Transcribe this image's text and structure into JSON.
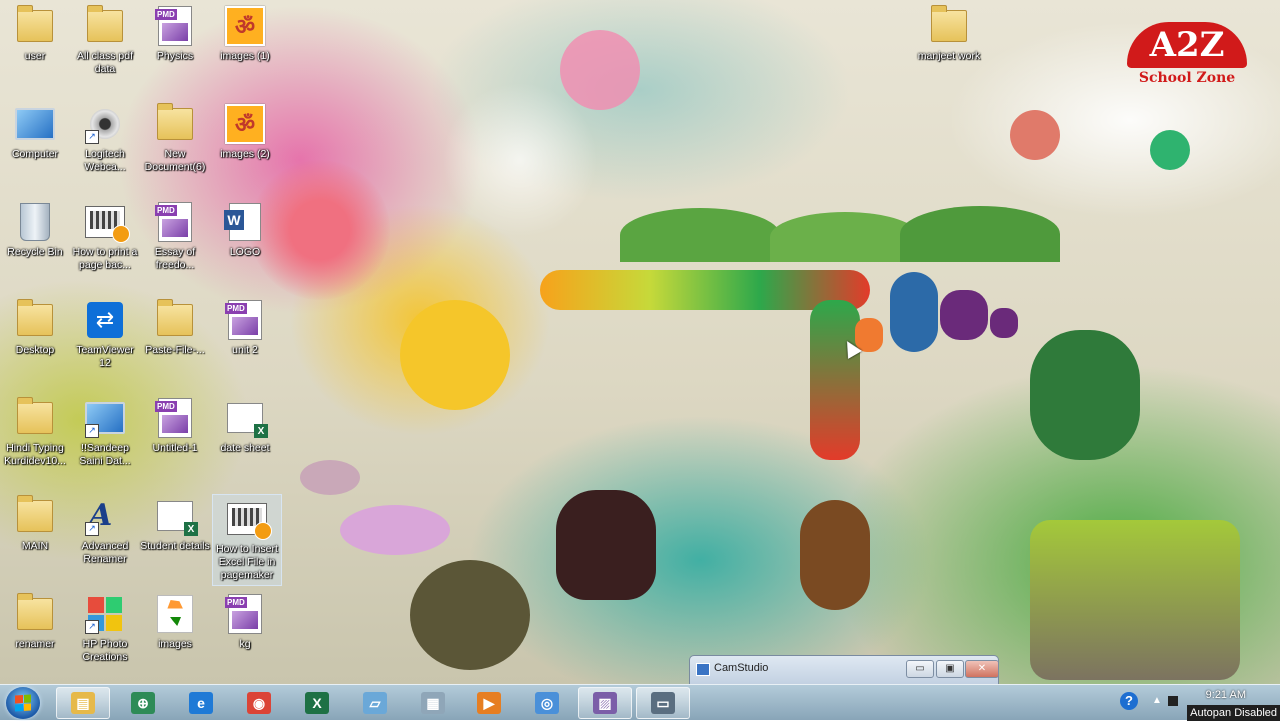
{
  "desktop": {
    "icons": [
      {
        "label": "user",
        "type": "user-folder-icon"
      },
      {
        "label": "All class pdf data",
        "type": "folder-icon"
      },
      {
        "label": "Physics",
        "type": "pmd-file-icon"
      },
      {
        "label": "images (1)",
        "type": "om-image-icon"
      },
      {
        "label": "Computer",
        "type": "computer-icon"
      },
      {
        "label": "Logitech Webca...",
        "type": "webcam-icon"
      },
      {
        "label": "New Document(6)",
        "type": "folder-icon"
      },
      {
        "label": "images (2)",
        "type": "om-image-icon"
      },
      {
        "label": "Recycle Bin",
        "type": "recycle-bin-icon"
      },
      {
        "label": "How to print a page bac...",
        "type": "video-file-icon"
      },
      {
        "label": "Essay of freedo...",
        "type": "pmd-file-icon"
      },
      {
        "label": "LOGO",
        "type": "word-document-icon"
      },
      {
        "label": "Desktop",
        "type": "folder-icon"
      },
      {
        "label": "TeamViewer 12",
        "type": "teamviewer-icon"
      },
      {
        "label": "Paste-File-...",
        "type": "folder-icon"
      },
      {
        "label": "unit 2",
        "type": "pmd-file-icon"
      },
      {
        "label": "Hindi Typing Kurdidev10...",
        "type": "folder-icon"
      },
      {
        "label": "!!Sandeep Saini Dat...",
        "type": "monitor-shortcut-icon"
      },
      {
        "label": "Untitled-1",
        "type": "pmd-file-icon"
      },
      {
        "label": "date sheet",
        "type": "excel-file-icon"
      },
      {
        "label": "MAIN",
        "type": "folder-icon"
      },
      {
        "label": "Advanced Renamer",
        "type": "renamer-icon"
      },
      {
        "label": "Student details",
        "type": "excel-file-icon"
      },
      {
        "label": "How to Insert Excel File in pagemaker",
        "type": "video-file-icon"
      },
      {
        "label": "renamer",
        "type": "folder-icon"
      },
      {
        "label": "HP Photo Creations",
        "type": "hp-photo-icon"
      },
      {
        "label": "images",
        "type": "india-map-icon"
      },
      {
        "label": "kg",
        "type": "pmd-file-icon"
      },
      {
        "label": "manjeet work",
        "type": "folder-icon"
      }
    ]
  },
  "logo": {
    "big": "A2Z",
    "small": "School Zone",
    "color": "#d11a1a"
  },
  "camstudio": {
    "title": "CamStudio",
    "minimize": "▭",
    "maximize": "▣",
    "close": "✕"
  },
  "taskbar": {
    "apps": [
      {
        "name": "explorer",
        "glyph": "▤",
        "color": "#e6b94a",
        "active": true
      },
      {
        "name": "map-app",
        "glyph": "⊕",
        "color": "#2e8b57",
        "active": false
      },
      {
        "name": "internet-explorer",
        "glyph": "e",
        "color": "#1f7ad6",
        "active": false
      },
      {
        "name": "chrome",
        "glyph": "◉",
        "color": "#db4437",
        "active": false
      },
      {
        "name": "excel",
        "glyph": "X",
        "color": "#1e7145",
        "active": false
      },
      {
        "name": "notes",
        "glyph": "▱",
        "color": "#6aa8d8",
        "active": false
      },
      {
        "name": "calculator",
        "glyph": "▦",
        "color": "#8fa6b8",
        "active": false
      },
      {
        "name": "media-player",
        "glyph": "▶",
        "color": "#e67e22",
        "active": false
      },
      {
        "name": "chrome-alt",
        "glyph": "◎",
        "color": "#4a90d9",
        "active": false
      },
      {
        "name": "paint",
        "glyph": "▨",
        "color": "#7b5ea8",
        "active": true
      },
      {
        "name": "camstudio",
        "glyph": "▭",
        "color": "#5a6e80",
        "active": true
      }
    ],
    "clock": "9:21 AM",
    "help": "?",
    "tray_arrow": "▲",
    "autopan": "Autopan Disabled"
  }
}
